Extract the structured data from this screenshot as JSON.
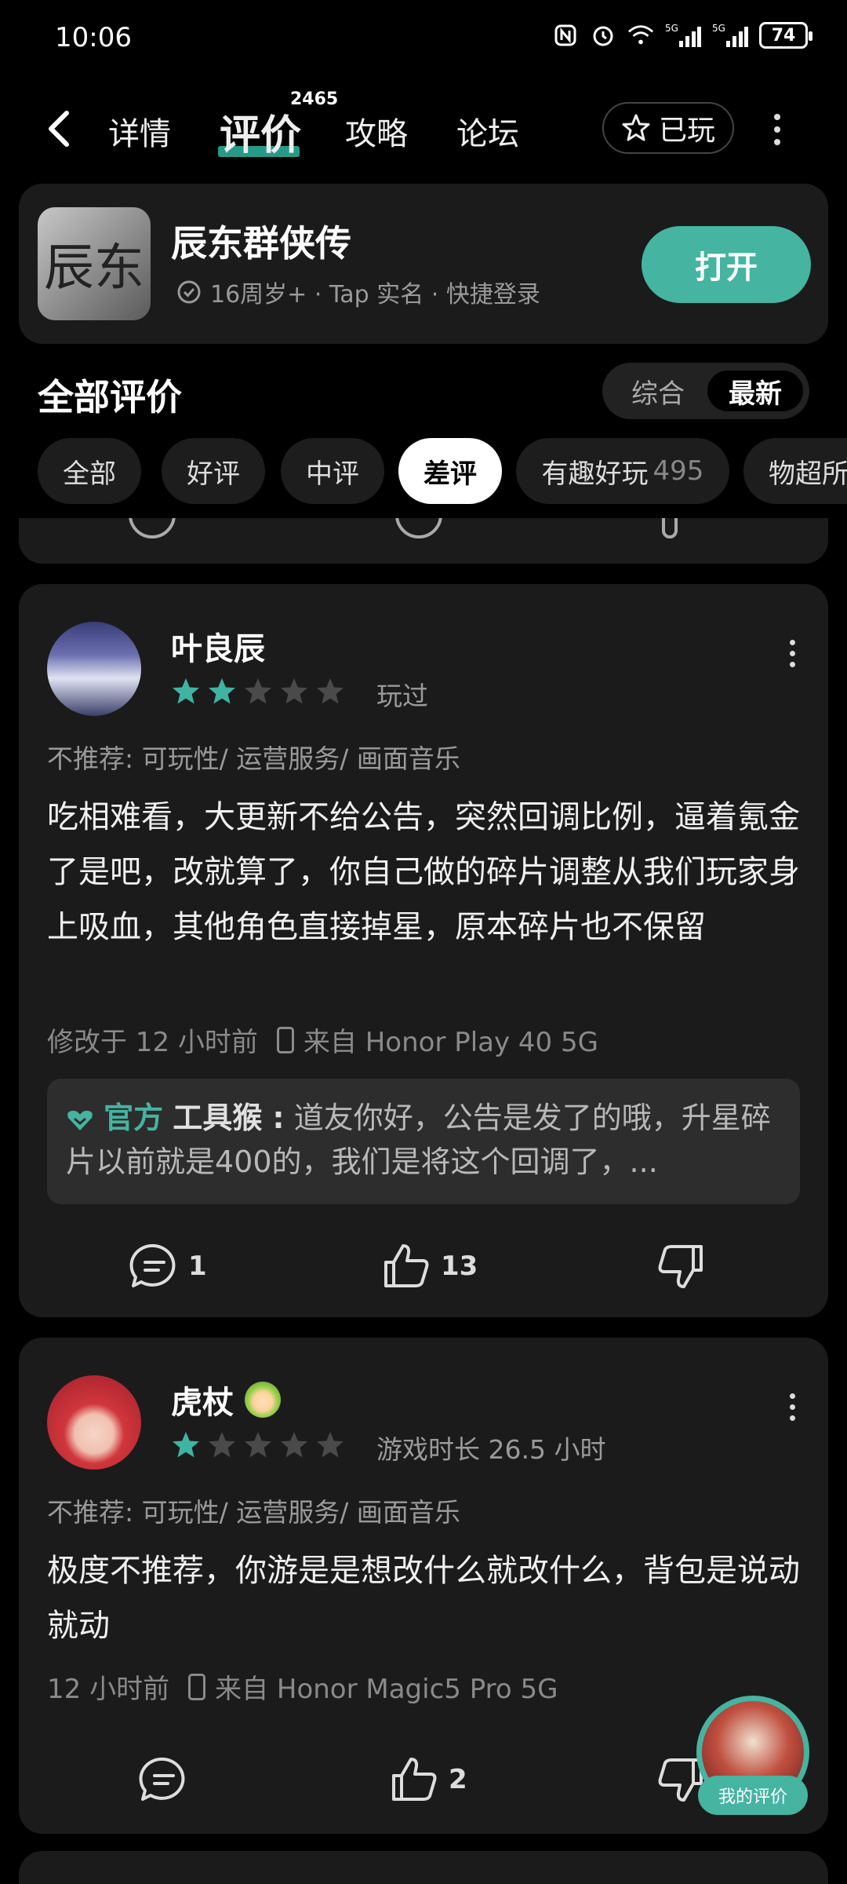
{
  "status_bar": {
    "time": "10:06",
    "battery": "74",
    "network1": "5G",
    "network2": "5G"
  },
  "nav": {
    "tabs": [
      {
        "label": "详情"
      },
      {
        "label": "评价",
        "count": "2465"
      },
      {
        "label": "攻略"
      },
      {
        "label": "论坛"
      }
    ],
    "played_label": "已玩"
  },
  "game": {
    "name": "辰东群侠传",
    "meta": "16周岁+ · Tap 实名 · 快捷登录",
    "open_label": "打开",
    "icon_text": "辰东"
  },
  "reviews_section": {
    "title": "全部评价",
    "sort_options": [
      "综合",
      "最新"
    ],
    "sort_selected": "最新",
    "filters": [
      {
        "label": "全部"
      },
      {
        "label": "好评"
      },
      {
        "label": "中评"
      },
      {
        "label": "差评",
        "selected": true
      },
      {
        "label": "有趣好玩",
        "count": "495"
      },
      {
        "label": "物超所值"
      }
    ]
  },
  "reviews": [
    {
      "name": "叶良辰",
      "rating": 2,
      "tag": "玩过",
      "not_recommended": "不推荐: 可玩性/ 运营服务/ 画面音乐",
      "body": "吃相难看，大更新不给公告，突然回调比例，逼着氪金了是吧，改就算了，你自己做的碎片调整从我们玩家身上吸血，其他角色直接掉星，原本碎片也不保留",
      "time": "修改于 12 小时前",
      "device": "来自 Honor Play 40 5G",
      "official": {
        "badge": "官方",
        "name": "工具猴 :",
        "text": "道友你好，公告是发了的哦，升星碎片以前就是400的，我们是将这个回调了，..."
      },
      "comments": "1",
      "likes": "13"
    },
    {
      "name": "虎杖",
      "rating": 1,
      "tag": "游戏时长 26.5 小时",
      "not_recommended": "不推荐: 可玩性/ 运营服务/ 画面音乐",
      "body": "极度不推荐，你游是是想改什么就改什么，背包是说动就动",
      "time": "12 小时前",
      "device": "来自 Honor Magic5 Pro 5G",
      "comments": "",
      "likes": "2"
    }
  ],
  "my_review_label": "我的评价",
  "colors": {
    "accent": "#45b4a1",
    "star_on": "#3fb4a3",
    "star_off": "#4a4a4a",
    "card": "#1b1b1b"
  }
}
